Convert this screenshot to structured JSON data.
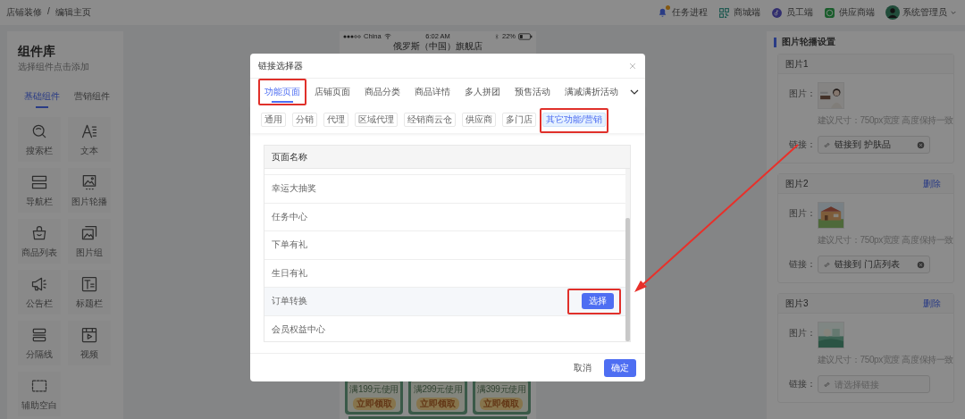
{
  "top_bar": {
    "breadcrumb": [
      "店铺装修",
      "编辑主页"
    ],
    "separator": "/",
    "links": [
      {
        "kind": "bell",
        "label": "任务进程",
        "badge": true
      },
      {
        "kind": "qr",
        "label": "商城端",
        "badge": false
      },
      {
        "kind": "staff",
        "label": "员工端",
        "badge": false
      },
      {
        "kind": "supplier",
        "label": "供应商端",
        "badge": false
      }
    ],
    "user": {
      "name": "系统管理员"
    }
  },
  "component_library": {
    "title": "组件库",
    "subtitle": "选择组件点击添加",
    "tabs": [
      {
        "label": "基础组件",
        "selected": true
      },
      {
        "label": "营销组件",
        "selected": false
      }
    ],
    "items": [
      {
        "kind": "search",
        "label": "搜索栏"
      },
      {
        "kind": "text",
        "label": "文本"
      },
      {
        "kind": "nav",
        "label": "导航栏"
      },
      {
        "kind": "carousel",
        "label": "图片轮播"
      },
      {
        "kind": "product_list",
        "label": "商品列表"
      },
      {
        "kind": "image_group",
        "label": "图片组"
      },
      {
        "kind": "notice",
        "label": "公告栏"
      },
      {
        "kind": "title",
        "label": "标题栏"
      },
      {
        "kind": "divider",
        "label": "分隔线"
      },
      {
        "kind": "video",
        "label": "视频"
      },
      {
        "kind": "blank",
        "label": "辅助空白"
      }
    ]
  },
  "phone": {
    "carrier": "China",
    "time": "6:02 AM",
    "battery": "22%",
    "title": "俄罗斯（中国）旗舰店",
    "coupons": [
      {
        "condition": "满199元使用",
        "button": "立即领取"
      },
      {
        "condition": "满299元使用",
        "button": "立即领取"
      },
      {
        "condition": "满399元使用",
        "button": "立即领取"
      }
    ]
  },
  "settings": {
    "title": "图片轮播设置",
    "cards": [
      {
        "title": "图片1",
        "image_label": "图片：",
        "hint": "建议尺寸：750px宽度 高度保持一致",
        "link_label": "链接：",
        "link": "链接到 护肤品"
      },
      {
        "title": "图片2",
        "delete": "删除",
        "image_label": "图片：",
        "hint": "建议尺寸：750px宽度 高度保持一致",
        "link_label": "链接：",
        "link": "链接到 门店列表"
      },
      {
        "title": "图片3",
        "delete": "删除",
        "image_label": "图片：",
        "hint": "建议尺寸：750px宽度 高度保持一致",
        "link_label": "链接：",
        "placeholder": "请选择链接"
      }
    ]
  },
  "link_selector": {
    "title": "链接选择器",
    "tabs": [
      {
        "label": "功能页面",
        "selected": true,
        "highlighted": true
      },
      {
        "label": "店铺页面",
        "selected": false,
        "highlighted": false
      },
      {
        "label": "商品分类",
        "selected": false,
        "highlighted": false
      },
      {
        "label": "商品详情",
        "selected": false,
        "highlighted": false
      },
      {
        "label": "多人拼团",
        "selected": false,
        "highlighted": false
      },
      {
        "label": "预售活动",
        "selected": false,
        "highlighted": false
      },
      {
        "label": "满减满折活动",
        "selected": false,
        "highlighted": false
      }
    ],
    "subtabs": [
      {
        "label": "通用",
        "selected": false,
        "highlighted": false
      },
      {
        "label": "分销",
        "selected": false,
        "highlighted": false
      },
      {
        "label": "代理",
        "selected": false,
        "highlighted": false
      },
      {
        "label": "区域代理",
        "selected": false,
        "highlighted": false
      },
      {
        "label": "经销商云仓",
        "selected": false,
        "highlighted": false
      },
      {
        "label": "供应商",
        "selected": false,
        "highlighted": false
      },
      {
        "label": "多门店",
        "selected": false,
        "highlighted": false
      },
      {
        "label": "其它功能/营销",
        "selected": true,
        "highlighted": true
      }
    ],
    "table": {
      "column": "页面名称",
      "rows": [
        {
          "name": "幸运大抽奖"
        },
        {
          "name": "任务中心"
        },
        {
          "name": "下单有礼"
        },
        {
          "name": "生日有礼"
        },
        {
          "name": "订单转换",
          "button": {
            "label": "选择",
            "highlighted": true
          }
        },
        {
          "name": "会员权益中心"
        }
      ]
    },
    "cancel": "取消",
    "confirm": "确定"
  }
}
